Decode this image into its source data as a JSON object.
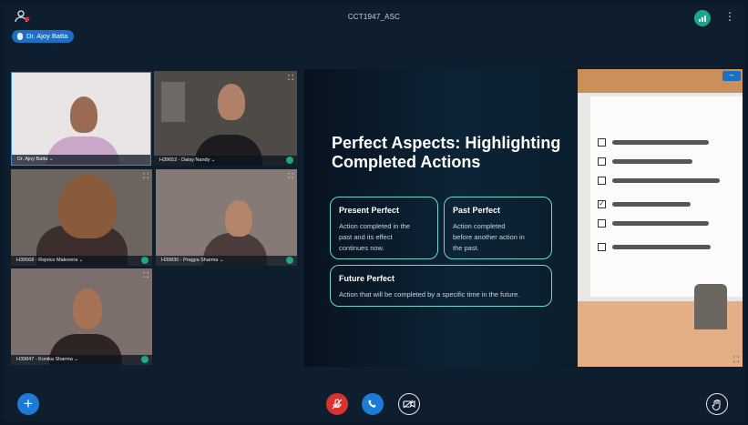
{
  "meeting": {
    "title": "CCT1947_ASC"
  },
  "presenter": {
    "name": "Dr. Ajoy Batta"
  },
  "participants": [
    {
      "label": "Dr. Ajoy Batta  ⌄"
    },
    {
      "label": "H39652 - Daisy Nandy  ⌄"
    },
    {
      "label": "H39568 - Rejoice Makorera  ⌄"
    },
    {
      "label": "H39830 - Pragya Sharma  ⌄"
    },
    {
      "label": "H39847 - Konika Sharma  ⌄"
    }
  ],
  "slide": {
    "title": "Perfect Aspects: Highlighting Completed Actions",
    "cards": [
      {
        "heading": "Present Perfect",
        "desc": [
          "Action completed in the",
          "past and its effect",
          "continues now."
        ]
      },
      {
        "heading": "Past Perfect",
        "desc": [
          "Action completed",
          "before another action in",
          "the past."
        ]
      },
      {
        "heading": "Future Perfect",
        "desc": [
          "Action that will be completed by a specific time in the future."
        ]
      }
    ]
  },
  "icons": {
    "participants": "participants-icon",
    "signal": "signal-strength-icon",
    "more": "more-options-icon",
    "expand": "expand-icon",
    "add": "add-icon",
    "mute": "mic-off-icon",
    "call": "phone-icon",
    "camera": "camera-off-icon",
    "hand": "raise-hand-icon"
  },
  "colors": {
    "accent": "#1d7ad6",
    "danger": "#d9322e",
    "teal": "#1fa58a",
    "cardBorder": "#6fd6d0"
  }
}
